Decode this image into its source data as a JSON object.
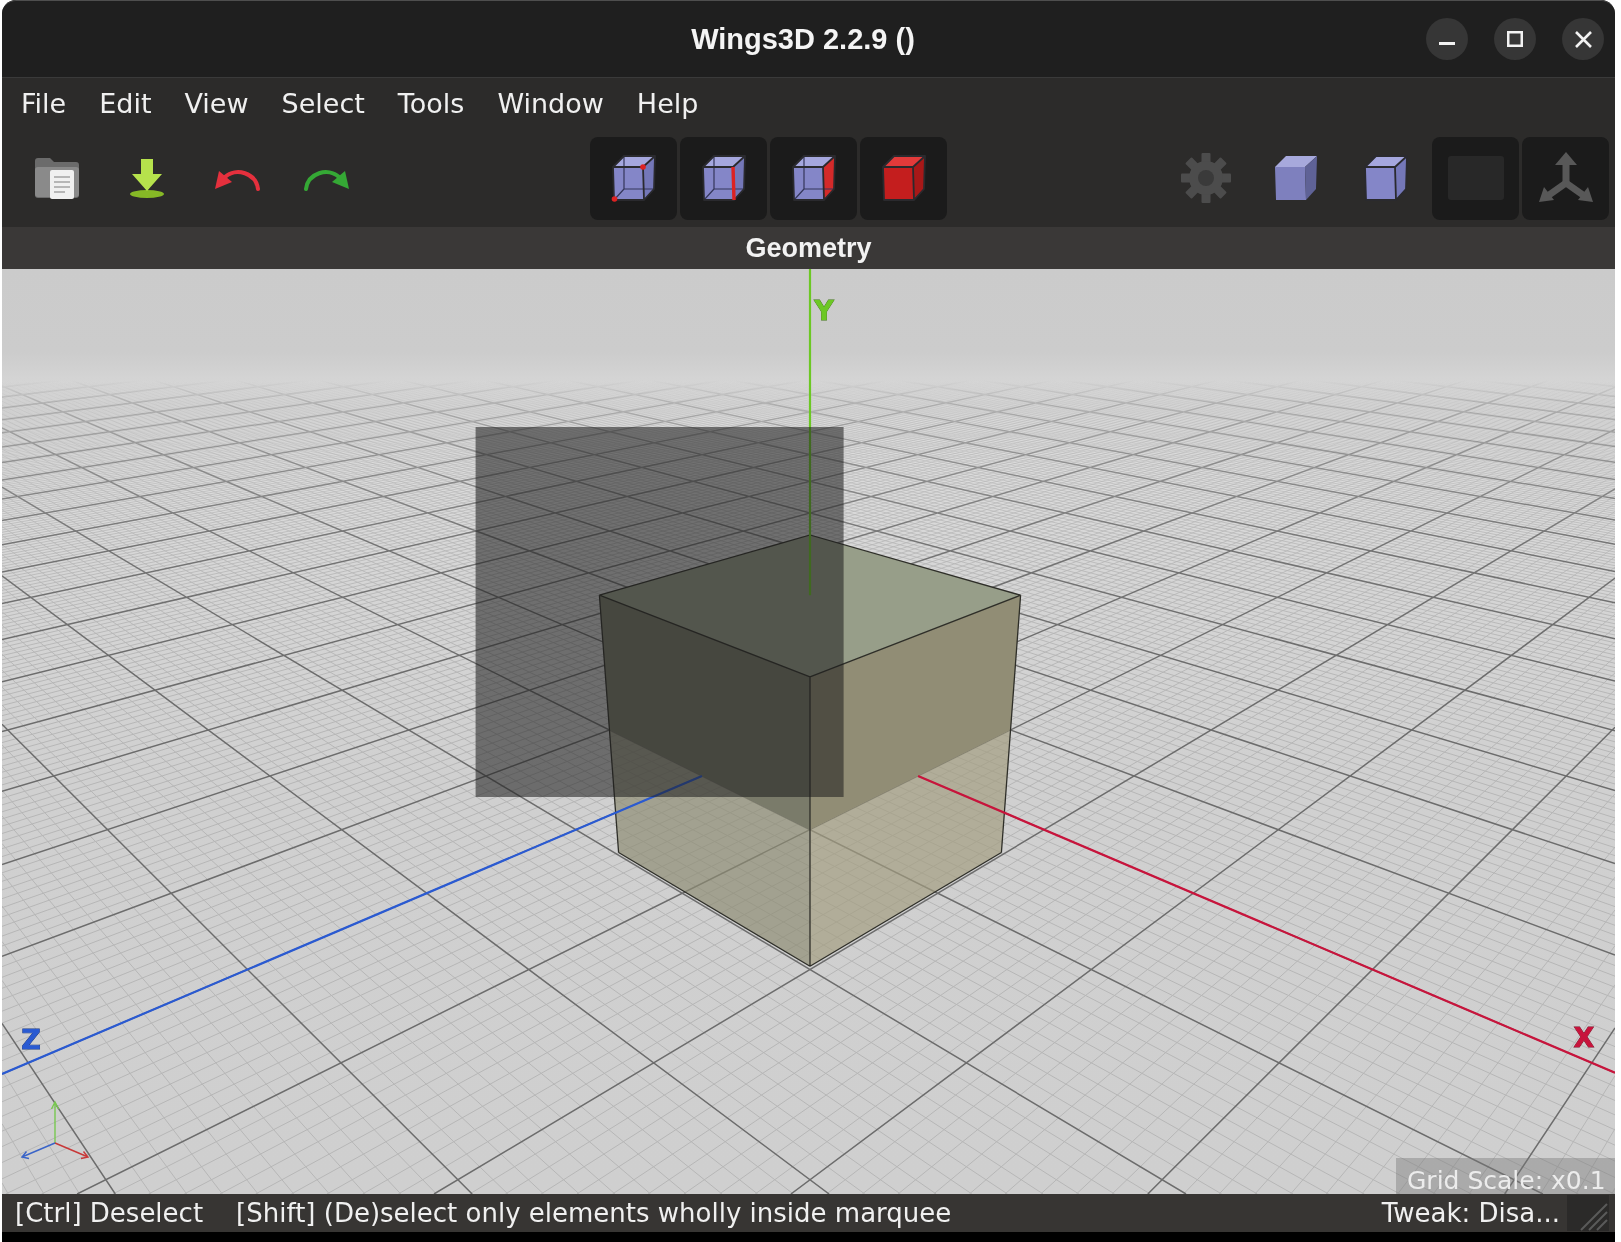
{
  "window": {
    "title": "Wings3D 2.2.9 ()"
  },
  "menu": [
    "File",
    "Edit",
    "View",
    "Select",
    "Tools",
    "Window",
    "Help"
  ],
  "toolbar": {
    "view_toggles": [
      {
        "pressed": false
      },
      {
        "pressed": false
      },
      {
        "pressed": false
      },
      {
        "pressed": true
      },
      {
        "pressed": true
      }
    ]
  },
  "viewport": {
    "title": "Geometry",
    "axes": [
      {
        "kind": "x",
        "label": "X",
        "color": "#c8143c"
      },
      {
        "kind": "y",
        "label": "Y",
        "color": "#6cc824"
      },
      {
        "kind": "z",
        "label": "Z",
        "color": "#2a5ad2"
      }
    ],
    "grid_scale": "Grid Scale: x0.1"
  },
  "status_bar": {
    "hints": [
      "[Ctrl] Deselect",
      "[Shift] (De)select only elements wholly inside marquee"
    ],
    "tweak": "Tweak: Disa..."
  }
}
